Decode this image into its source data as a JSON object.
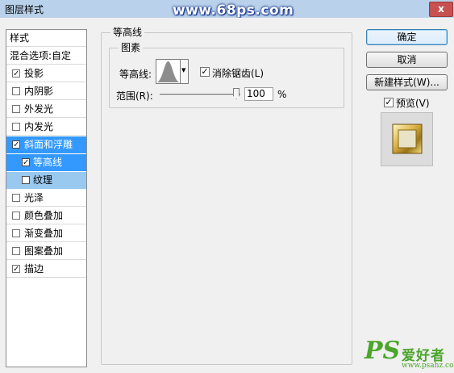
{
  "window": {
    "title": "图层样式",
    "watermark": "www.68ps.com",
    "close_glyph": "x"
  },
  "style_list": {
    "header": "样式",
    "blend_options": "混合选项:自定",
    "items": [
      {
        "label": "投影",
        "checked": true
      },
      {
        "label": "内阴影",
        "checked": false
      },
      {
        "label": "外发光",
        "checked": false
      },
      {
        "label": "内发光",
        "checked": false
      },
      {
        "label": "斜面和浮雕",
        "checked": true,
        "selected": true
      },
      {
        "label": "等高线",
        "checked": true,
        "sub": true,
        "selected": true
      },
      {
        "label": "纹理",
        "checked": false,
        "sub": true,
        "highlight": true
      },
      {
        "label": "光泽",
        "checked": false
      },
      {
        "label": "颜色叠加",
        "checked": false
      },
      {
        "label": "渐变叠加",
        "checked": false
      },
      {
        "label": "图案叠加",
        "checked": false
      },
      {
        "label": "描边",
        "checked": true
      }
    ]
  },
  "contour_panel": {
    "title": "等高线",
    "group": "图素",
    "contour_label": "等高线:",
    "anti_alias_label": "消除锯齿(L)",
    "anti_alias_checked": true,
    "range_label": "范围(R):",
    "range_value": "100",
    "range_unit": "%"
  },
  "buttons": {
    "ok": "确定",
    "cancel": "取消",
    "new_style": "新建样式(W)...",
    "preview_label": "预览(V)",
    "preview_checked": true
  },
  "logo": {
    "ps": "PS",
    "name": "爱好者",
    "url": "www.psahz.com"
  },
  "icons": {
    "checkmark": "✓",
    "dropdown": "▼"
  }
}
